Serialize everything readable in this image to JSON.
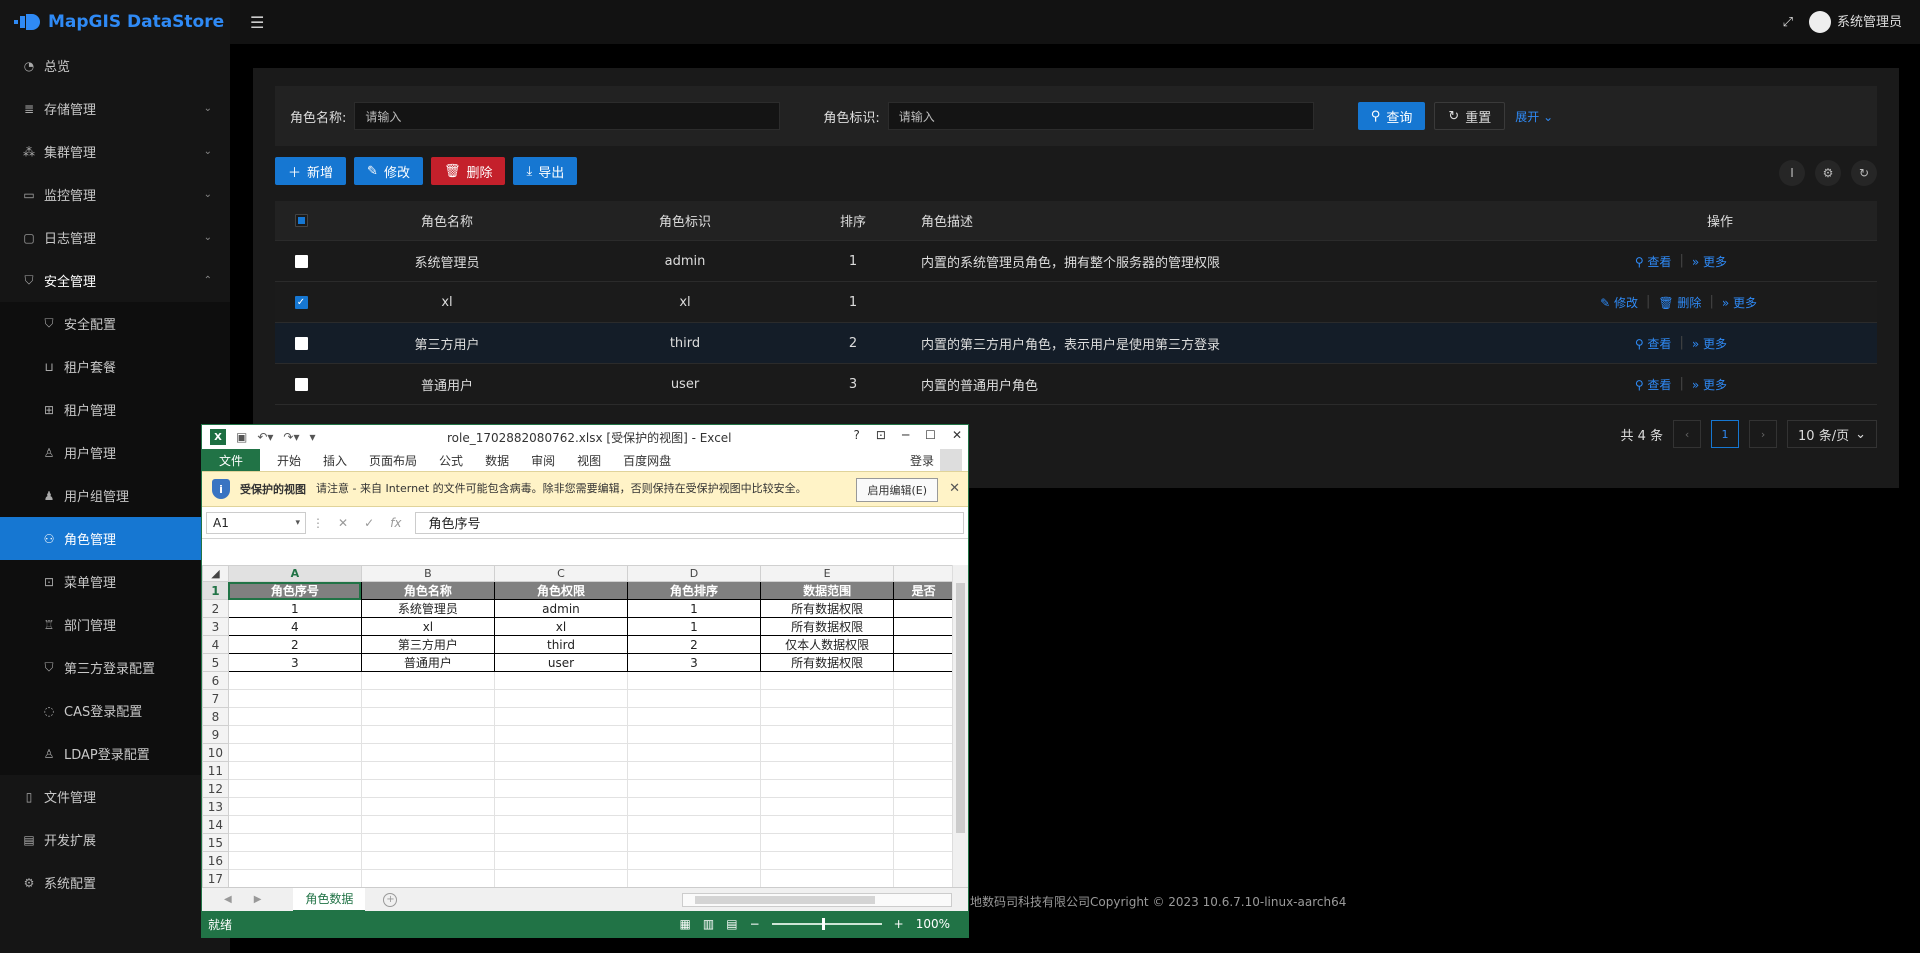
{
  "app": {
    "name": "MapGIS DataStore",
    "user": "系统管理员",
    "footer": "地数码司科技有限公司Copyright © 2023 10.6.7.10-linux-aarch64"
  },
  "sidebar": {
    "items": [
      {
        "label": "总览",
        "icon": "dashboard-icon"
      },
      {
        "label": "存储管理",
        "icon": "database-icon"
      },
      {
        "label": "集群管理",
        "icon": "cluster-icon"
      },
      {
        "label": "监控管理",
        "icon": "monitor-icon"
      },
      {
        "label": "日志管理",
        "icon": "log-icon"
      },
      {
        "label": "安全管理",
        "icon": "shield-icon"
      }
    ],
    "security_sub": [
      {
        "label": "安全配置"
      },
      {
        "label": "租户套餐"
      },
      {
        "label": "租户管理"
      },
      {
        "label": "用户管理"
      },
      {
        "label": "用户组管理"
      },
      {
        "label": "角色管理"
      },
      {
        "label": "菜单管理"
      },
      {
        "label": "部门管理"
      },
      {
        "label": "第三方登录配置"
      },
      {
        "label": "CAS登录配置"
      },
      {
        "label": "LDAP登录配置"
      }
    ],
    "bottom_items": [
      {
        "label": "文件管理"
      },
      {
        "label": "开发扩展"
      },
      {
        "label": "系统配置"
      }
    ]
  },
  "search": {
    "role_name_label": "角色名称:",
    "role_name_placeholder": "请输入",
    "role_id_label": "角色标识:",
    "role_id_placeholder": "请输入",
    "query": "查询",
    "reset": "重置",
    "expand": "展开"
  },
  "toolbar": {
    "add": "新增",
    "edit": "修改",
    "delete": "删除",
    "export": "导出"
  },
  "table": {
    "headers": {
      "name": "角色名称",
      "id": "角色标识",
      "order": "排序",
      "desc": "角色描述",
      "ops": "操作"
    },
    "rows": [
      {
        "name": "系统管理员",
        "id": "admin",
        "order": "1",
        "desc": "内置的系统管理员角色，拥有整个服务器的管理权限"
      },
      {
        "name": "xl",
        "id": "xl",
        "order": "1",
        "desc": ""
      },
      {
        "name": "第三方用户",
        "id": "third",
        "order": "2",
        "desc": "内置的第三方用户角色，表示用户是使用第三方登录"
      },
      {
        "name": "普通用户",
        "id": "user",
        "order": "3",
        "desc": "内置的普通用户角色"
      }
    ],
    "op_view": "查看",
    "op_more": "更多",
    "op_edit": "修改",
    "op_delete": "删除"
  },
  "pager": {
    "total": "共 4 条",
    "page": "1",
    "size": "10 条/页"
  },
  "excel": {
    "title": "role_1702882080762.xlsx  [受保护的视图] - Excel",
    "file_tab": "文件",
    "tabs": [
      "开始",
      "插入",
      "页面布局",
      "公式",
      "数据",
      "审阅",
      "视图",
      "百度网盘"
    ],
    "login": "登录",
    "protect_title": "受保护的视图",
    "protect_msg": "请注意 - 来自 Internet 的文件可能包含病毒。除非您需要编辑，否则保持在受保护视图中比较安全。",
    "enable_edit": "启用编辑(E)",
    "name_box": "A1",
    "formula": "角色序号",
    "col_letters": [
      "A",
      "B",
      "C",
      "D",
      "E"
    ],
    "headers": [
      "角色序号",
      "角色名称",
      "角色权限",
      "角色排序",
      "数据范围",
      "是否"
    ],
    "rows": [
      [
        "1",
        "系统管理员",
        "admin",
        "1",
        "所有数据权限"
      ],
      [
        "4",
        "xl",
        "xl",
        "1",
        "所有数据权限"
      ],
      [
        "2",
        "第三方用户",
        "third",
        "2",
        "仅本人数据权限"
      ],
      [
        "3",
        "普通用户",
        "user",
        "3",
        "所有数据权限"
      ]
    ],
    "row_numbers": [
      "1",
      "2",
      "3",
      "4",
      "5",
      "6",
      "7",
      "8",
      "9",
      "10",
      "11",
      "12",
      "13",
      "14",
      "15",
      "16",
      "17"
    ],
    "sheet_name": "角色数据",
    "status": "就绪",
    "zoom": "100%"
  }
}
